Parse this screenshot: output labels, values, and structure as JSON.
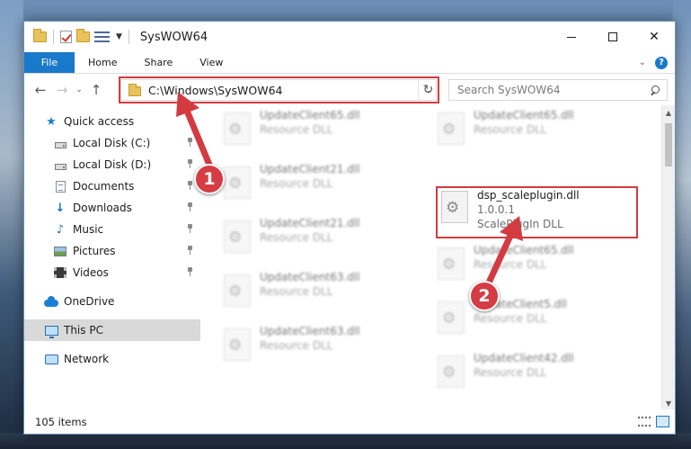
{
  "window": {
    "title": "SysWOW64"
  },
  "ribbon": {
    "file": "File",
    "tabs": [
      "Home",
      "Share",
      "View"
    ]
  },
  "address": {
    "path": "C:\\Windows\\SysWOW64"
  },
  "search": {
    "placeholder": "Search SysWOW64"
  },
  "nav": {
    "items": [
      {
        "label": "Quick access",
        "icon": "star-icon"
      },
      {
        "label": "Local Disk (C:)",
        "icon": "drive-icon",
        "pinned": true
      },
      {
        "label": "Local Disk (D:)",
        "icon": "drive-icon",
        "pinned": true
      },
      {
        "label": "Documents",
        "icon": "documents-icon",
        "pinned": true
      },
      {
        "label": "Downloads",
        "icon": "download-icon",
        "pinned": true
      },
      {
        "label": "Music",
        "icon": "music-icon",
        "pinned": true
      },
      {
        "label": "Pictures",
        "icon": "pictures-icon",
        "pinned": true
      },
      {
        "label": "Videos",
        "icon": "videos-icon",
        "pinned": true
      },
      {
        "label": "OneDrive",
        "icon": "cloud-icon"
      },
      {
        "label": "This PC",
        "icon": "monitor-icon",
        "selected": true
      },
      {
        "label": "Network",
        "icon": "network-icon"
      }
    ]
  },
  "files": {
    "left_column": [
      {
        "name": "UpdateClient65.dll",
        "type": "Resource DLL"
      },
      {
        "name": "UpdateClient21.dll",
        "type": "Resource DLL"
      },
      {
        "name": "UpdateClient21.dll",
        "type": "Resource DLL"
      },
      {
        "name": "UpdateClient63.dll",
        "type": "Resource DLL"
      },
      {
        "name": "UpdateClient63.dll",
        "type": "Resource DLL"
      }
    ],
    "right_column": [
      {
        "name": "UpdateClient65.dll",
        "type": "Resource DLL"
      },
      {
        "name": "UpdateClient65.dll",
        "type": "Resource DLL"
      },
      {
        "name": "UpdateClient5.dll",
        "type": "Resource DLL"
      },
      {
        "name": "UpdateClient42.dll",
        "type": "Resource DLL"
      }
    ],
    "highlighted": {
      "name": "dsp_scaleplugin.dll",
      "version": "1.0.0.1",
      "type": "ScalePlugIn DLL"
    }
  },
  "status": {
    "item_count": "105 items"
  },
  "annotations": {
    "step1": "1",
    "step2": "2",
    "color": "#d23b40"
  }
}
